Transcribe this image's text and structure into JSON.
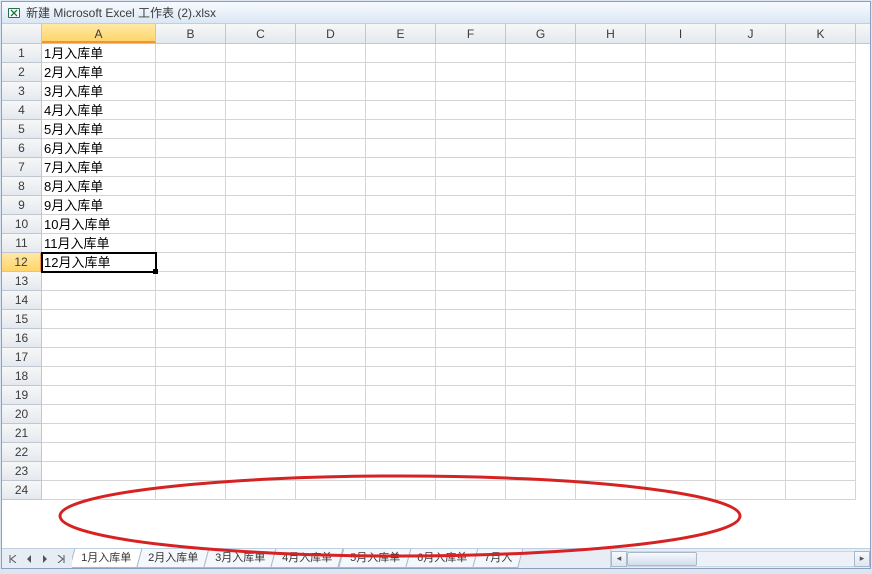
{
  "window": {
    "title": "新建 Microsoft Excel 工作表 (2).xlsx"
  },
  "columns": [
    "A",
    "B",
    "C",
    "D",
    "E",
    "F",
    "G",
    "H",
    "I",
    "J",
    "K"
  ],
  "col_widths": {
    "A": 114,
    "B": 70,
    "C": 70,
    "D": 70,
    "E": 70,
    "F": 70,
    "G": 70,
    "H": 70,
    "I": 70,
    "J": 70,
    "K": 70
  },
  "visible_rows": 24,
  "active_cell": {
    "row": 12,
    "col": "A"
  },
  "cells": {
    "A": [
      "1月入库单",
      "2月入库单",
      "3月入库单",
      "4月入库单",
      "5月入库单",
      "6月入库单",
      "7月入库单",
      "8月入库单",
      "9月入库单",
      "10月入库单",
      "11月入库单",
      "12月入库单"
    ]
  },
  "sheet_tabs": [
    "1月入库单",
    "2月入库单",
    "3月入库单",
    "4月入库单",
    "5月入库单",
    "6月入库单",
    "7月入"
  ],
  "active_tab": 0
}
